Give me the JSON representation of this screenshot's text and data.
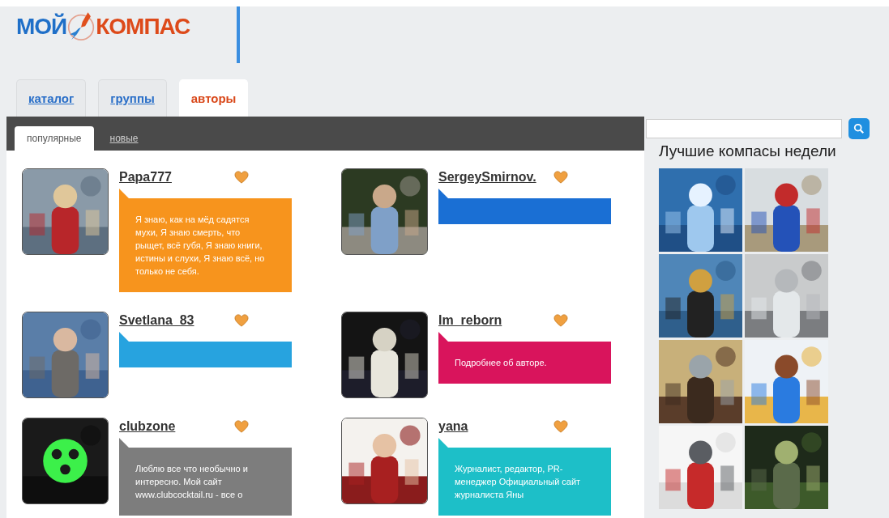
{
  "logo": {
    "left": "МОЙ",
    "right": "КОМПАС"
  },
  "tabs": [
    {
      "label": "каталог",
      "selected": false
    },
    {
      "label": "группы",
      "selected": false
    },
    {
      "label": "авторы",
      "selected": true
    }
  ],
  "subtabs": [
    {
      "label": "популярные",
      "selected": true
    },
    {
      "label": "новые",
      "selected": false
    }
  ],
  "authors": [
    {
      "name": "Papa777",
      "color": "#f7941d",
      "bio": "Я знаю, как на мёд садятся мухи, Я знаю смерть, что рыщет, всё губя, Я знаю книги, истины и слухи, Я знаю всё, но только не себя."
    },
    {
      "name": "SergeySmirnov.",
      "color": "#1a6fd4"
    },
    {
      "name": "Svetlana_83",
      "color": "#27a3df"
    },
    {
      "name": "Im_reborn",
      "color": "#d9145c",
      "bio": "Подробнее об авторе."
    },
    {
      "name": "clubzone",
      "color": "#7d7d7d",
      "bio": "Люблю все что необычно и интересно. Мой сайт www.clubcocktail.ru - все о"
    },
    {
      "name": "yana",
      "color": "#1dbfc8",
      "bio": "Журналист, редактор, PR-менеджер Официальный сайт журналиста Яны"
    }
  ],
  "best": {
    "title": "Лучшие компасы недели"
  }
}
